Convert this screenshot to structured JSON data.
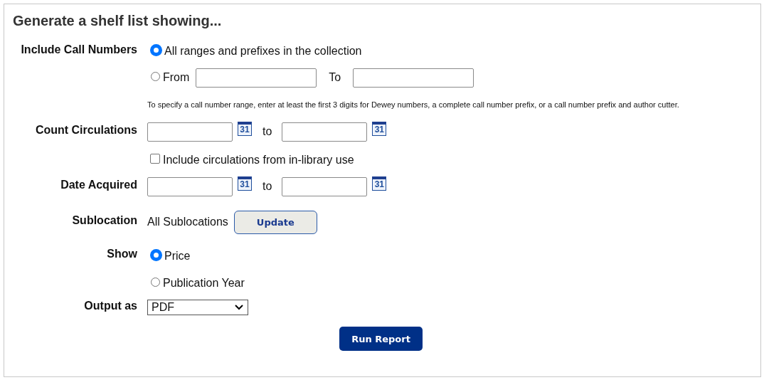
{
  "title": "Generate a shelf list showing...",
  "call_numbers": {
    "label": "Include Call Numbers",
    "options": [
      {
        "kind": "all",
        "label": "All ranges and prefixes in the collection",
        "selected": true
      },
      {
        "kind": "range",
        "label": "From",
        "to_label": "To",
        "selected": false
      }
    ],
    "hint": "To specify a call number range, enter at least the first 3 digits for Dewey numbers, a complete call number prefix, or a call number prefix and author cutter."
  },
  "count_circulations": {
    "label": "Count Circulations",
    "calendar_icons": [
      "31",
      "31"
    ],
    "to": "to",
    "in_library": {
      "label": "Include circulations from in-library use",
      "checked": false
    }
  },
  "date_acquired": {
    "label": "Date Acquired",
    "calendar_icons": [
      "31",
      "31"
    ],
    "to": "to"
  },
  "sublocation": {
    "label": "Sublocation",
    "value": "All Sublocations",
    "button": "Update"
  },
  "show": {
    "label": "Show",
    "options": [
      {
        "label": "Price",
        "selected": true
      },
      {
        "label": "Publication Year",
        "selected": false
      }
    ]
  },
  "output": {
    "label": "Output as",
    "value": "PDF"
  },
  "run_button": "Run Report"
}
